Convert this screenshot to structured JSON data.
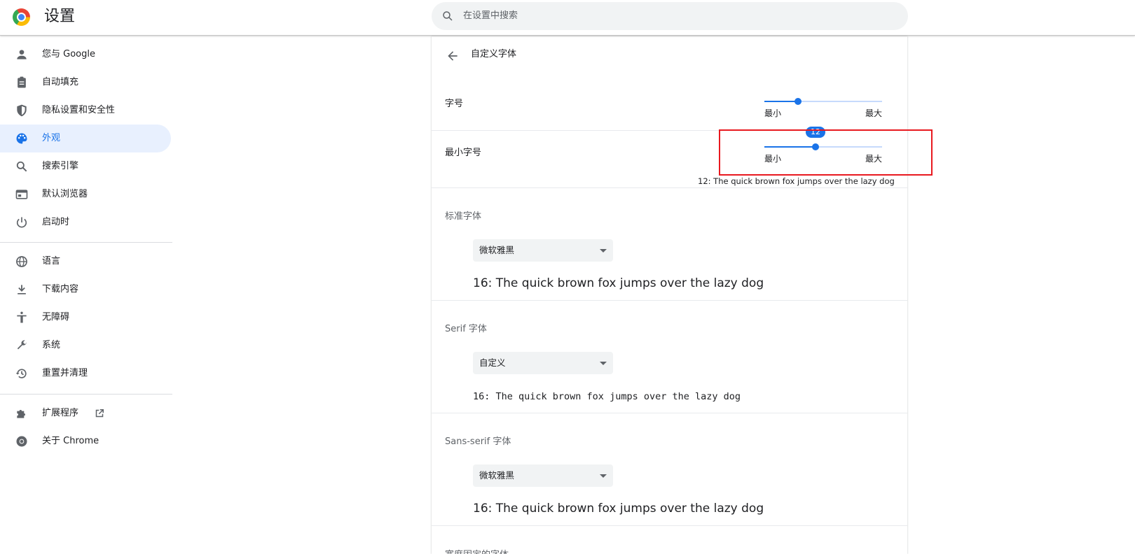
{
  "header": {
    "title": "设置",
    "search_placeholder": "在设置中搜索"
  },
  "sidebar": {
    "items": [
      {
        "label": "您与 Google",
        "icon": "person-icon"
      },
      {
        "label": "自动填充",
        "icon": "clipboard-icon"
      },
      {
        "label": "隐私设置和安全性",
        "icon": "shield-icon"
      },
      {
        "label": "外观",
        "icon": "palette-icon",
        "active": true
      },
      {
        "label": "搜索引擎",
        "icon": "search-icon"
      },
      {
        "label": "默认浏览器",
        "icon": "browser-icon"
      },
      {
        "label": "启动时",
        "icon": "power-icon"
      },
      {
        "label": "语言",
        "icon": "globe-icon"
      },
      {
        "label": "下载内容",
        "icon": "download-icon"
      },
      {
        "label": "无障碍",
        "icon": "accessibility-icon"
      },
      {
        "label": "系统",
        "icon": "wrench-icon"
      },
      {
        "label": "重置并清理",
        "icon": "history-icon"
      },
      {
        "label": "扩展程序",
        "icon": "puzzle-icon",
        "external": true
      },
      {
        "label": "关于 Chrome",
        "icon": "chrome-icon"
      }
    ]
  },
  "page": {
    "subpage_title": "自定义字体",
    "font_size": {
      "label": "字号",
      "min_label": "最小",
      "max_label": "最大",
      "level": 0.29
    },
    "min_font_size": {
      "label": "最小字号",
      "min_label": "最小",
      "max_label": "最大",
      "value": "12",
      "level": 0.43,
      "preview": "12: The quick brown fox jumps over the lazy dog"
    },
    "standard_font": {
      "label": "标准字体",
      "selected": "微软雅黑",
      "sample": "16: The quick brown fox jumps over the lazy dog"
    },
    "serif_font": {
      "label": "Serif 字体",
      "selected": "自定义",
      "sample": "16: The quick brown fox jumps over the lazy dog"
    },
    "sans_serif_font": {
      "label": "Sans-serif 字体",
      "selected": "微软雅黑",
      "sample": "16: The quick brown fox jumps over the lazy dog"
    },
    "fixed_width_font": {
      "label": "宽度固定的字体"
    }
  },
  "colors": {
    "accent": "#1a73e8",
    "active_bg": "#e8f0fe",
    "highlight": "#e8191f"
  }
}
